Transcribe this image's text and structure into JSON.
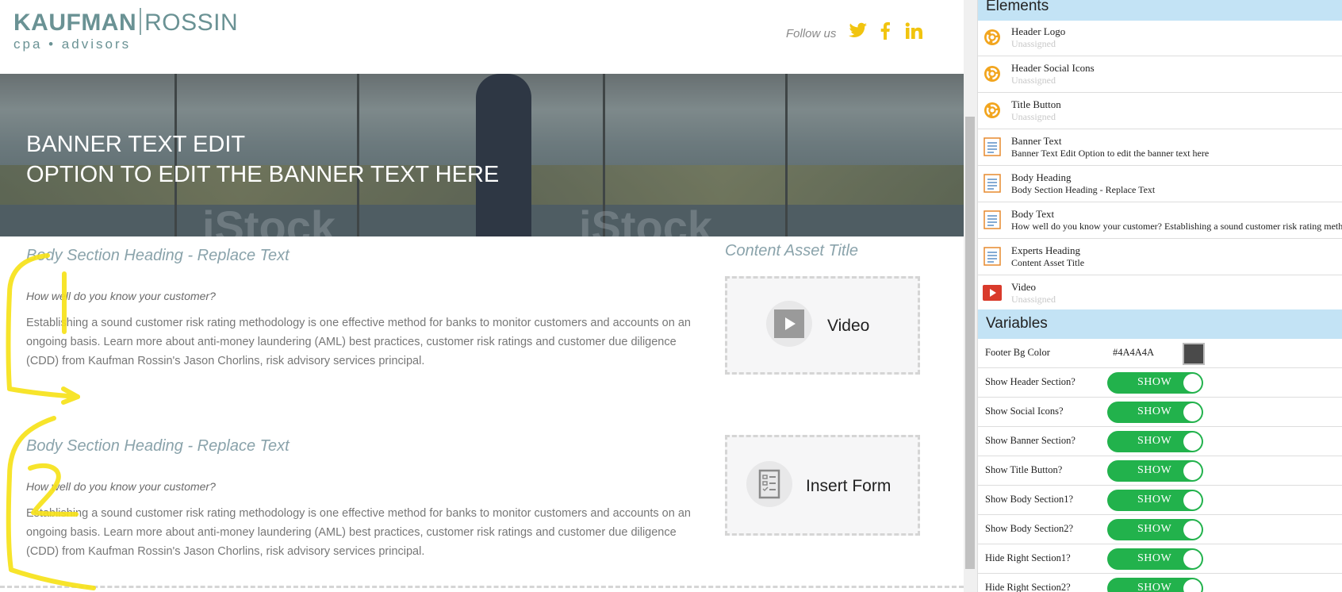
{
  "colors": {
    "accent_yellow": "#f1c40f",
    "logo_teal": "#6a9294",
    "toggle_green": "#22b24c",
    "section_header_bg": "#c3e3f5",
    "footer_bg": "#4A4A4A"
  },
  "header": {
    "logo": {
      "part1": "KAUFMAN",
      "part2": "ROSSIN",
      "tagline": "cpa • advisors"
    },
    "follow_label": "Follow us",
    "social_icons": [
      "twitter-icon",
      "facebook-icon",
      "linkedin-icon"
    ]
  },
  "banner": {
    "line1": "BANNER TEXT EDIT",
    "line2": "OPTION TO EDIT THE BANNER TEXT HERE",
    "watermark": "iStock"
  },
  "body_sections": [
    {
      "heading": "Body Section Heading - Replace Text",
      "question": "How well do you know your customer?",
      "paragraph": "Establishing a sound customer risk rating methodology is one effective method for banks to monitor customers and accounts on an ongoing basis. Learn more about anti-money laundering (AML) best practices, customer risk ratings and customer due diligence (CDD) from Kaufman Rossin's Jason Chorlins, risk advisory services principal."
    },
    {
      "heading": "Body Section Heading - Replace Text",
      "question": "How well do you know your customer?",
      "paragraph": "Establishing a sound customer risk rating methodology is one effective method for banks to monitor customers and accounts on an ongoing basis. Learn more about anti-money laundering (AML) best practices, customer risk ratings and customer due diligence (CDD) from Kaufman Rossin's Jason Chorlins, risk advisory services principal."
    }
  ],
  "right_column": {
    "asset_title": "Content Asset Title",
    "video_label": "Video",
    "form_label": "Insert Form"
  },
  "annotations": {
    "mark1": "1",
    "mark2": "2"
  },
  "panel": {
    "elements_title": "Elements",
    "elements": [
      {
        "name": "Header Logo",
        "value": "Unassigned",
        "icon": "asset-icon"
      },
      {
        "name": "Header Social Icons",
        "value": "Unassigned",
        "icon": "asset-icon"
      },
      {
        "name": "Title Button",
        "value": "Unassigned",
        "icon": "asset-icon"
      },
      {
        "name": "Banner Text",
        "value": "Banner Text Edit Option to edit the banner text here",
        "icon": "text-doc-icon"
      },
      {
        "name": "Body Heading",
        "value": "Body Section Heading - Replace Text",
        "icon": "text-doc-icon"
      },
      {
        "name": "Body Text",
        "value": "How well do you know your customer? Establishing a sound customer risk rating meth",
        "icon": "text-doc-icon"
      },
      {
        "name": "Experts Heading",
        "value": "Content Asset Title",
        "icon": "text-doc-icon"
      },
      {
        "name": "Video",
        "value": "Unassigned",
        "icon": "video-icon"
      }
    ],
    "variables_title": "Variables",
    "variables": [
      {
        "name": "Footer Bg Color",
        "type": "color",
        "value": "#4A4A4A"
      },
      {
        "name": "Show Header Section?",
        "type": "toggle",
        "value": "SHOW"
      },
      {
        "name": "Show Social Icons?",
        "type": "toggle",
        "value": "SHOW"
      },
      {
        "name": "Show Banner Section?",
        "type": "toggle",
        "value": "SHOW"
      },
      {
        "name": "Show Title Button?",
        "type": "toggle",
        "value": "SHOW"
      },
      {
        "name": "Show Body Section1?",
        "type": "toggle",
        "value": "SHOW"
      },
      {
        "name": "Show Body Section2?",
        "type": "toggle",
        "value": "SHOW"
      },
      {
        "name": "Hide Right Section1?",
        "type": "toggle",
        "value": "SHOW"
      },
      {
        "name": "Hide Right Section2?",
        "type": "toggle",
        "value": "SHOW"
      }
    ]
  }
}
